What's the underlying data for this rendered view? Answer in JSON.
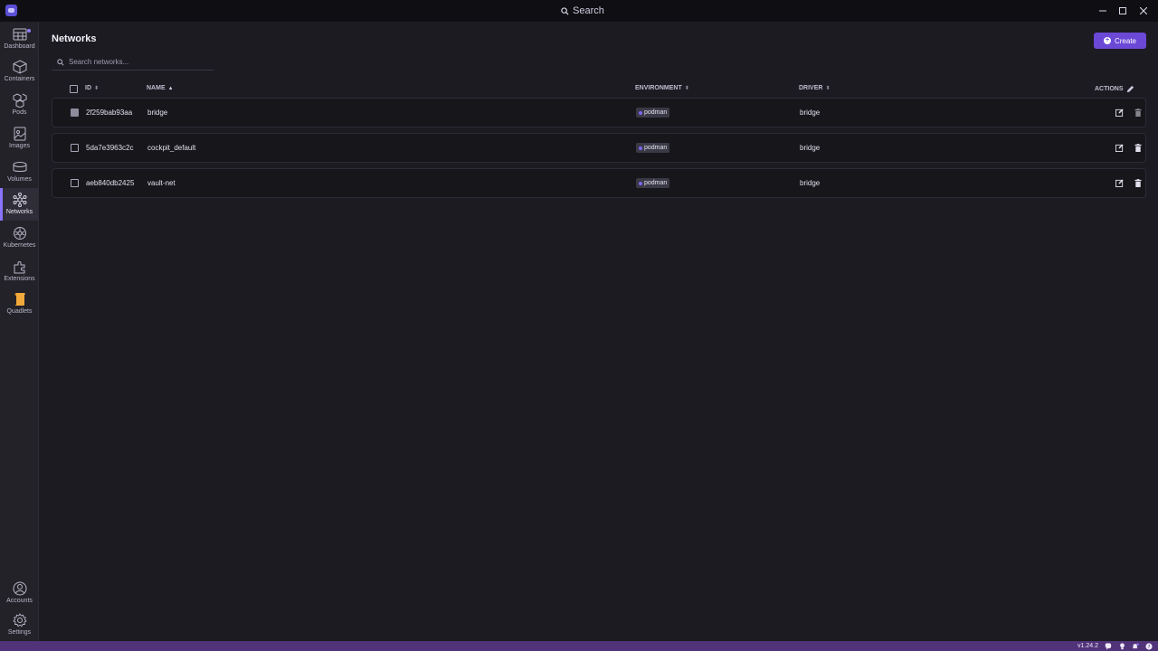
{
  "titlebar": {
    "search_label": "Search",
    "controls": [
      "minimize",
      "maximize",
      "close"
    ]
  },
  "sidebar": {
    "items": [
      {
        "label": "Dashboard",
        "icon": "dashboard-icon",
        "active": false,
        "badge": true
      },
      {
        "label": "Containers",
        "icon": "container-icon",
        "active": false
      },
      {
        "label": "Pods",
        "icon": "pods-icon",
        "active": false
      },
      {
        "label": "Images",
        "icon": "images-icon",
        "active": false
      },
      {
        "label": "Volumes",
        "icon": "volumes-icon",
        "active": false
      },
      {
        "label": "Networks",
        "icon": "networks-icon",
        "active": true
      },
      {
        "label": "Kubernetes",
        "icon": "kubernetes-icon",
        "active": false
      },
      {
        "label": "Extensions",
        "icon": "extensions-icon",
        "active": false
      },
      {
        "label": "Quadlets",
        "icon": "quadlets-icon",
        "active": false
      }
    ],
    "bottom_items": [
      {
        "label": "Accounts",
        "icon": "account-icon"
      },
      {
        "label": "Settings",
        "icon": "settings-icon"
      }
    ]
  },
  "main": {
    "title": "Networks",
    "create_label": "Create",
    "search_placeholder": "Search networks...",
    "columns": {
      "id": "ID",
      "name": "NAME",
      "environment": "ENVIRONMENT",
      "driver": "DRIVER",
      "actions": "ACTIONS"
    },
    "rows": [
      {
        "id": "2f259bab93aa",
        "name": "bridge",
        "environment": "podman",
        "driver": "bridge",
        "checkbox_disabled": true
      },
      {
        "id": "5da7e3963c2c",
        "name": "cockpit_default",
        "environment": "podman",
        "driver": "bridge",
        "checkbox_disabled": false
      },
      {
        "id": "aeb840db2425",
        "name": "vault-net",
        "environment": "podman",
        "driver": "bridge",
        "checkbox_disabled": false
      }
    ]
  },
  "statusbar": {
    "version": "v1.24.2"
  },
  "colors": {
    "accent": "#6b48d6",
    "statusbar": "#51337a",
    "background": "#1c1b22",
    "sidebar": "#232229"
  }
}
